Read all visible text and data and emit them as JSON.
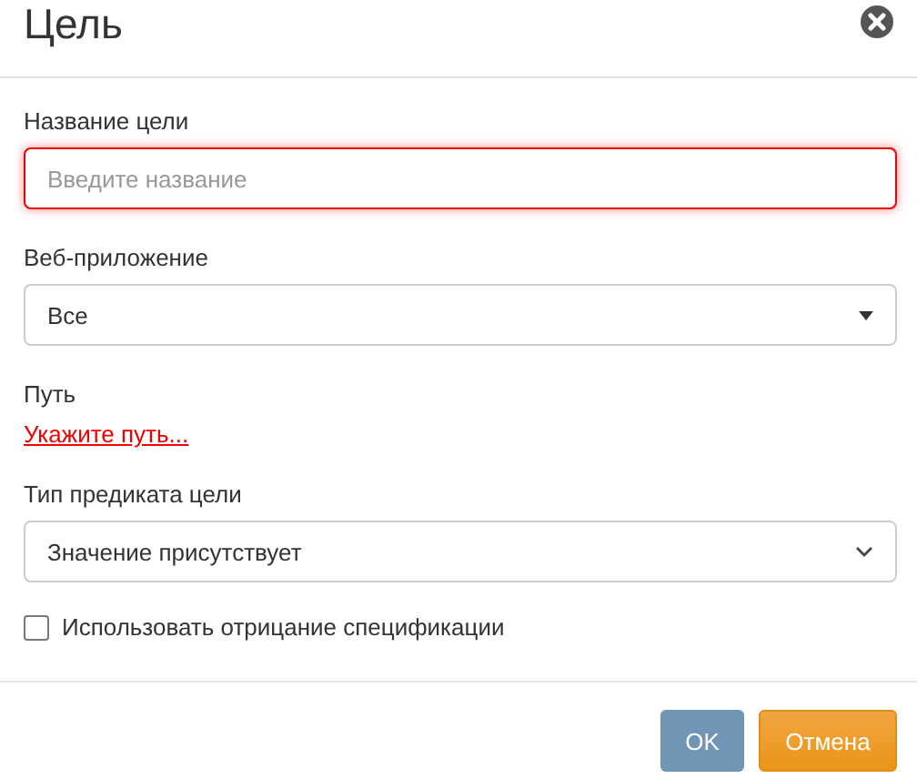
{
  "dialog": {
    "title": "Цель"
  },
  "name_field": {
    "label": "Название цели",
    "placeholder": "Введите название",
    "invalid": true
  },
  "web_app": {
    "label": "Веб-приложение",
    "value": "Все"
  },
  "path": {
    "label": "Путь",
    "link": "Укажите путь..."
  },
  "predicate_type": {
    "label": "Тип предиката цели",
    "value": "Значение присутствует"
  },
  "negation": {
    "label": "Использовать отрицание спецификации",
    "checked": false
  },
  "buttons": [
    {
      "kind": "primary",
      "label": "OK"
    },
    {
      "kind": "warning",
      "label": "Отмена"
    }
  ]
}
